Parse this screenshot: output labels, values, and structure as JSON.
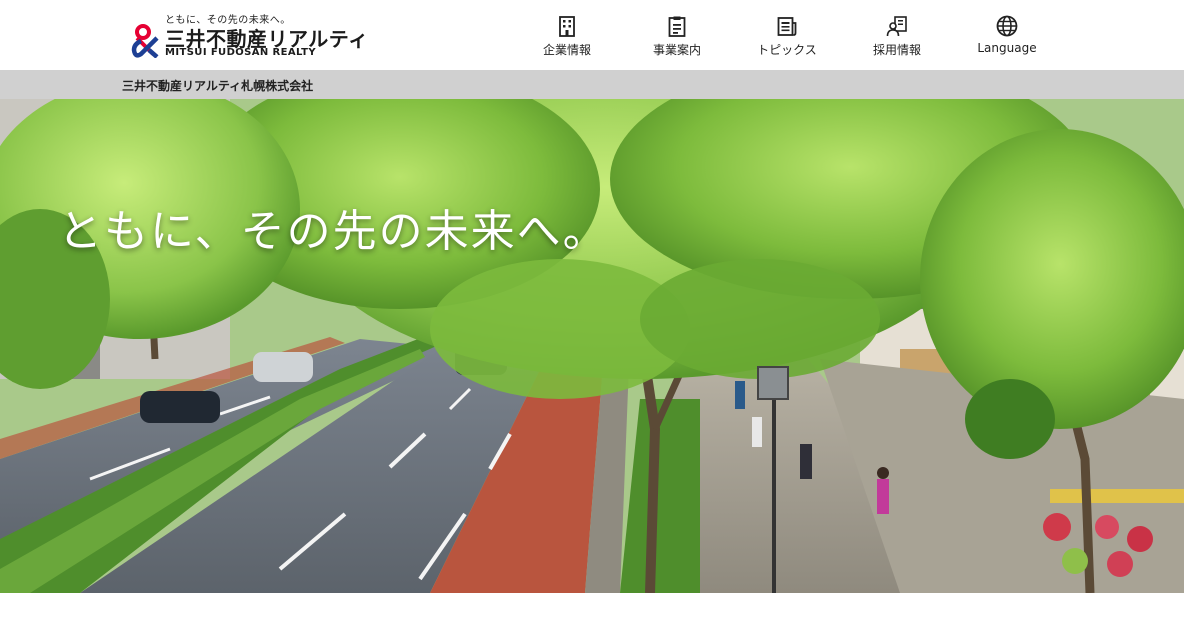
{
  "header": {
    "logo": {
      "tagline": "ともに、その先の未来へ。",
      "name_jp": "三井不動産リアルティ",
      "name_en": "MITSUI FUDOSAN REALTY"
    },
    "nav": [
      {
        "label": "企業情報",
        "icon": "building-icon"
      },
      {
        "label": "事業案内",
        "icon": "clipboard-icon"
      },
      {
        "label": "トピックス",
        "icon": "news-icon"
      },
      {
        "label": "採用情報",
        "icon": "recruit-icon"
      },
      {
        "label": "Language",
        "icon": "globe-icon"
      }
    ]
  },
  "company_bar": {
    "name": "三井不動産リアルティ札幌株式会社"
  },
  "hero": {
    "headline": "ともに、その先の未来へ。"
  },
  "colors": {
    "logo_red": "#e60033",
    "logo_blue": "#1d3f94",
    "company_bar_bg": "#d0d0d0"
  }
}
